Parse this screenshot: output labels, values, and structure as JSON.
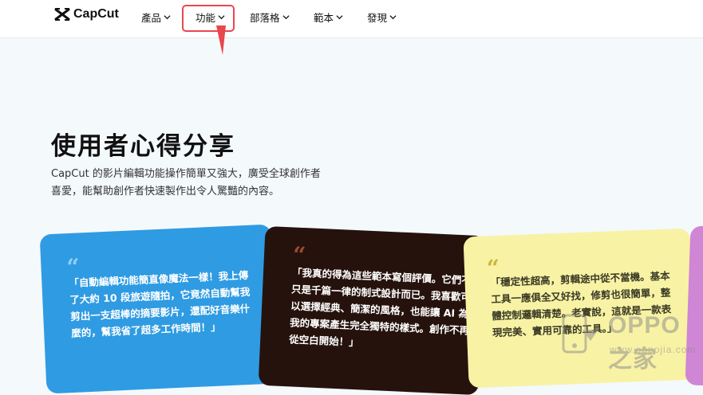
{
  "brand": {
    "name": "CapCut"
  },
  "nav": {
    "products": "產品",
    "features": "功能",
    "blog": "部落格",
    "templates": "範本",
    "discover": "發現"
  },
  "hero": {
    "title": "使用者心得分享",
    "description": "CapCut 的影片編輯功能操作簡單又強大，廣受全球創作者喜愛，能幫助創作者快速製作出令人驚豔的內容。"
  },
  "testimonials": [
    {
      "quote_mark": "“",
      "text": "「自動編輯功能簡直像魔法一樣！我上傳了大約 10 段旅遊隨拍，它竟然自動幫我剪出一支超棒的摘要影片，還配好音樂什麼的，幫我省了超多工作時間！」"
    },
    {
      "quote_mark": "“",
      "text": "「我真的得為這些範本寫個評價。它們不只是千篇一律的制式設計而已。我喜歡可以選擇經典、簡潔的風格，也能讓 AI 為我的專案產生完全獨特的樣式。創作不再從空白開始！」"
    },
    {
      "quote_mark": "“",
      "text": "「穩定性超高，剪輯途中從不當機。基本工具一應俱全又好找，修剪也很簡單，整體控制邏輯清楚。老實說，這就是一款表現完美、實用可靠的工具。」"
    }
  ],
  "watermark": {
    "brand": "OPPO之家",
    "url": "www.oppojia.com"
  },
  "colors": {
    "highlight": "#e8474d",
    "card_blue": "#2f9be2",
    "card_dark": "#26120c",
    "card_yellow": "#f8f2a5",
    "card_pink": "#cf86d4"
  }
}
